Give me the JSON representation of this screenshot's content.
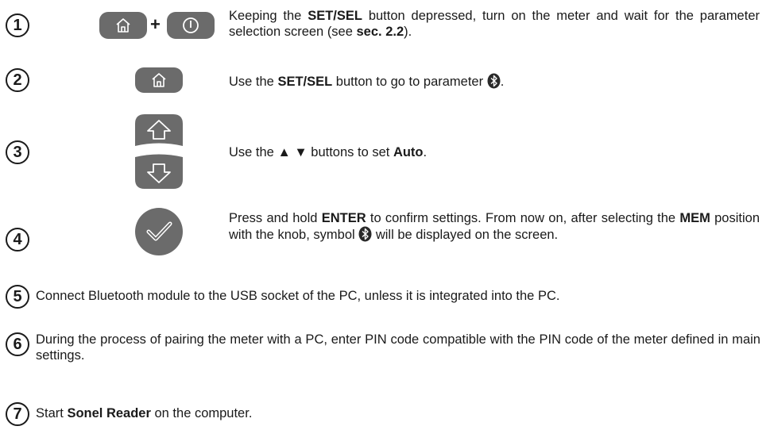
{
  "steps": [
    {
      "n": "1",
      "parts": [
        {
          "t": "Keeping the "
        },
        {
          "t": "SET/SEL",
          "b": true
        },
        {
          "t": " button depressed, turn on the meter and wait for the parameter selection screen (see "
        },
        {
          "t": "sec. 2.2",
          "b": true
        },
        {
          "t": ")."
        }
      ]
    },
    {
      "n": "2",
      "parts": [
        {
          "t": "Use the "
        },
        {
          "t": "SET/SEL",
          "b": true
        },
        {
          "t": " button to go to parameter "
        },
        {
          "icon": "bluetooth"
        },
        {
          "t": "."
        }
      ]
    },
    {
      "n": "3",
      "parts": [
        {
          "t": "Use the ▲ ▼  buttons to set "
        },
        {
          "t": "Auto",
          "b": true
        },
        {
          "t": "."
        }
      ]
    },
    {
      "n": "4",
      "parts": [
        {
          "t": "Press and hold "
        },
        {
          "t": "ENTER",
          "b": true
        },
        {
          "t": " to confirm settings. From now on, after selecting the "
        },
        {
          "t": "MEM",
          "b": true
        },
        {
          "t": " position with the knob, symbol "
        },
        {
          "icon": "bluetooth"
        },
        {
          "t": " will be displayed on the screen."
        }
      ]
    },
    {
      "n": "5",
      "parts": [
        {
          "t": "Connect Bluetooth module to the USB socket of the PC, unless it is integrated into the PC."
        }
      ]
    },
    {
      "n": "6",
      "parts": [
        {
          "t": "During the process of pairing the meter with a PC, enter PIN code compatible with the PIN code of the meter defined in main settings."
        }
      ]
    },
    {
      "n": "7",
      "parts": [
        {
          "t": "Start "
        },
        {
          "t": "Sonel Reader",
          "b": true
        },
        {
          "t": " on the computer."
        }
      ]
    }
  ],
  "plus_sign": "+",
  "icons": [
    "home-icon",
    "power-icon",
    "arrow-up-icon",
    "arrow-down-icon",
    "check-icon",
    "bluetooth-icon"
  ],
  "colors": {
    "button_gray": "#6b6b6b",
    "text": "#1a1a1a"
  }
}
